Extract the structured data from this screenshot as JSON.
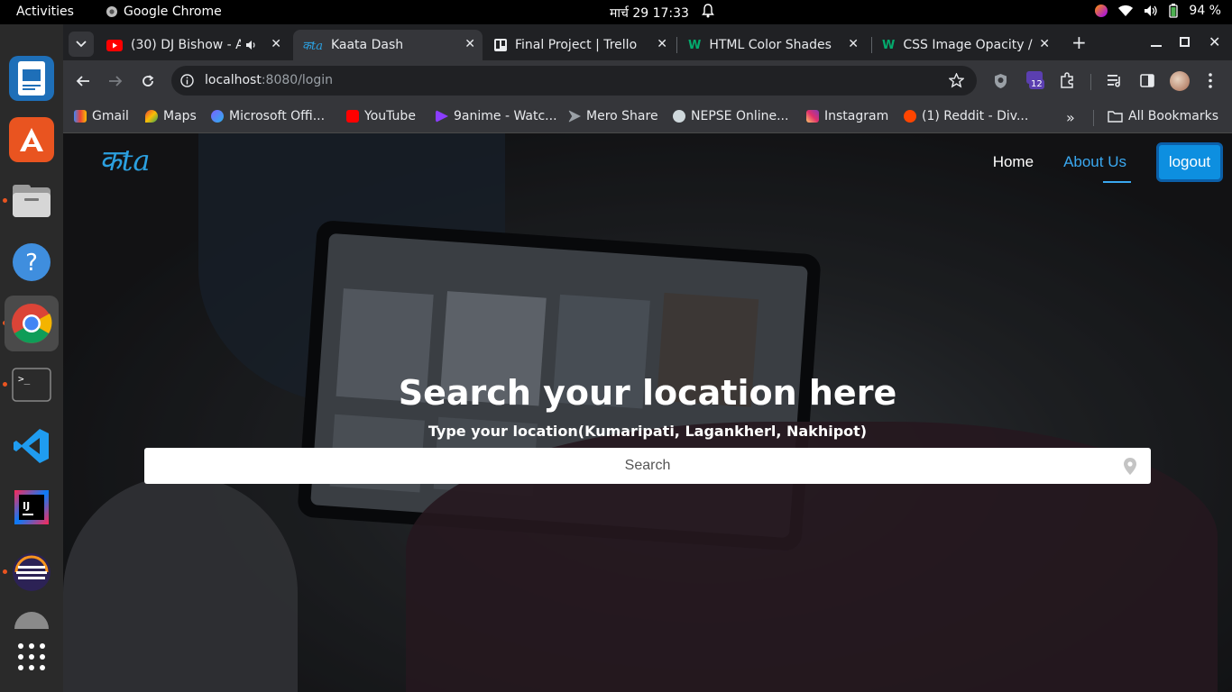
{
  "topbar": {
    "activities": "Activities",
    "app_name": "Google Chrome",
    "clock": "मार्च 29  17:33",
    "battery": "94 %"
  },
  "dock": {
    "items": [
      "office-writer",
      "app-center",
      "files",
      "help",
      "chrome",
      "terminal",
      "vscode",
      "intellij",
      "eclipse",
      "show-apps"
    ]
  },
  "tabs": [
    {
      "label": "(30) DJ Bishow - A",
      "icon": "youtube-icon"
    },
    {
      "label": "Kaata Dash",
      "icon": "kaata-icon"
    },
    {
      "label": "Final Project | Trello",
      "icon": "trello-icon"
    },
    {
      "label": "HTML Color Shades",
      "icon": "w3schools-icon"
    },
    {
      "label": "CSS Image Opacity / T",
      "icon": "w3schools-icon"
    }
  ],
  "toolbar": {
    "url_host": "localhost",
    "url_rest": ":8080/login",
    "extension_badge": "12"
  },
  "bookmarks": [
    {
      "label": "Gmail",
      "color": "#ea4335"
    },
    {
      "label": "Maps",
      "color": "#34a853"
    },
    {
      "label": "Microsoft Offi...",
      "color": "#7b61ff"
    },
    {
      "label": "YouTube",
      "color": "#ff0000"
    },
    {
      "label": "9anime - Watc...",
      "color": "#8b3dff"
    },
    {
      "label": "Mero Share",
      "color": "#9aa0a6"
    },
    {
      "label": "NEPSE Online...",
      "color": "#cfd8dc"
    },
    {
      "label": "Instagram",
      "color": "#e1306c"
    },
    {
      "label": "(1) Reddit - Div...",
      "color": "#ff4500"
    }
  ],
  "bookmarks_all": "All Bookmarks",
  "site": {
    "logo": "कta",
    "nav": {
      "home": "Home",
      "about": "About Us",
      "logout": "logout"
    },
    "hero_title": "Search your location here",
    "hero_subtitle": "Type your location(Kumaripati, Lagankherl, Nakhipot)",
    "search_placeholder": "Search"
  },
  "colors": {
    "accent": "#3aa8f0",
    "logout_bg": "#0d8fe0"
  }
}
